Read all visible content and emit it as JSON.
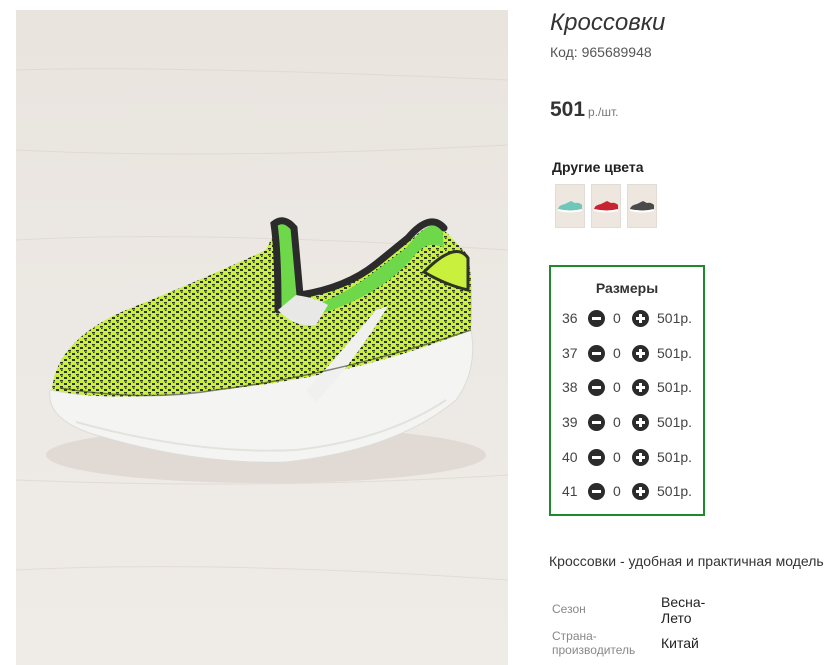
{
  "product": {
    "title": "Кроссовки",
    "code": "Код: 965689948",
    "price": "501",
    "price_unit": "р./шт."
  },
  "other_colors": {
    "title": "Другие цвета",
    "swatches": [
      {
        "name": "mint-sneaker",
        "color": "#6fc7b9"
      },
      {
        "name": "red-sneaker",
        "color": "#c8242f"
      },
      {
        "name": "grey-sneaker",
        "color": "#4a4a4a"
      }
    ]
  },
  "sizes": {
    "title": "Размеры",
    "rows": [
      {
        "size": "36",
        "qty": "0",
        "price": "501р."
      },
      {
        "size": "37",
        "qty": "0",
        "price": "501р."
      },
      {
        "size": "38",
        "qty": "0",
        "price": "501р."
      },
      {
        "size": "39",
        "qty": "0",
        "price": "501р."
      },
      {
        "size": "40",
        "qty": "0",
        "price": "501р."
      },
      {
        "size": "41",
        "qty": "0",
        "price": "501р."
      }
    ]
  },
  "description": "Кроссовки - удобная и практичная модель",
  "attributes": [
    {
      "label": "Сезон",
      "value": "Весна-\nЛето"
    },
    {
      "label": "Страна-\nпроизводитель",
      "value": "Китай"
    }
  ],
  "colors": {
    "accent_border": "#1e8a2e",
    "shoe_green": "#c8f03c"
  }
}
